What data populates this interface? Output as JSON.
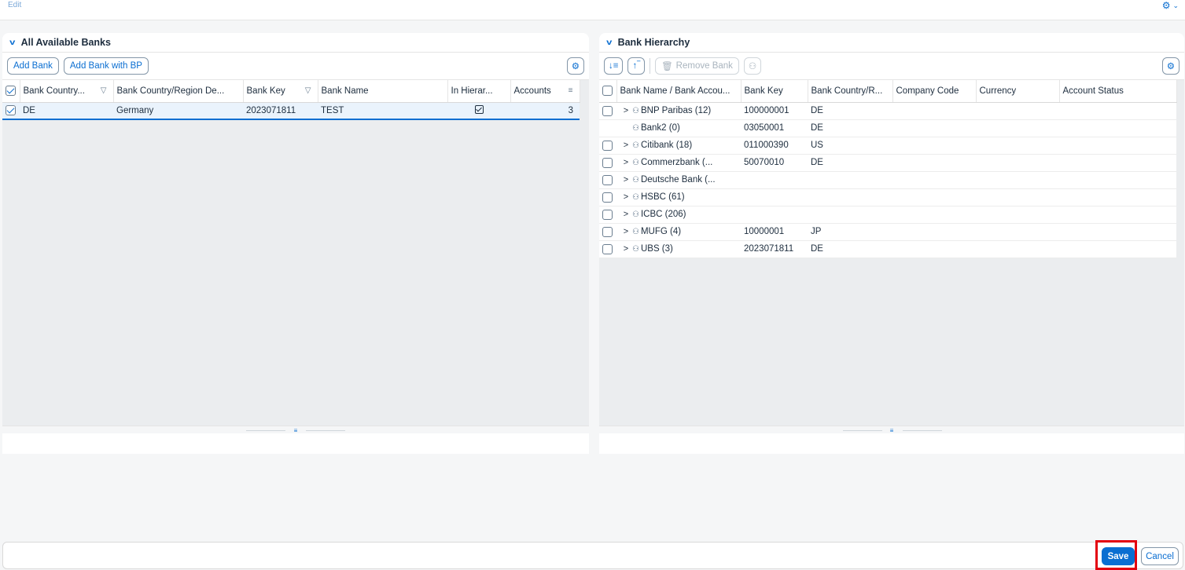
{
  "header": {
    "edit_label": "Edit"
  },
  "left_panel": {
    "title": "All Available Banks",
    "toolbar": {
      "add_bank": "Add Bank",
      "add_bank_bp": "Add Bank with BP"
    },
    "columns": [
      "Bank Country...",
      "Bank Country/Region De...",
      "Bank Key",
      "Bank Name",
      "In Hierar...",
      "Accounts"
    ],
    "rows": [
      {
        "country": "DE",
        "country_desc": "Germany",
        "bank_key": "2023071811",
        "bank_name": "TEST",
        "in_hierarchy": true,
        "accounts": "3",
        "selected": true
      }
    ]
  },
  "right_panel": {
    "title": "Bank Hierarchy",
    "toolbar": {
      "remove_bank": "Remove Bank"
    },
    "columns": [
      "Bank Name / Bank Accou...",
      "Bank Key",
      "Bank Country/R...",
      "Company Code",
      "Currency",
      "Account Status"
    ],
    "rows": [
      {
        "name": "BNP Paribas (12)",
        "bank_key": "100000001",
        "country": "DE",
        "expandable": true,
        "checkbox": true
      },
      {
        "name": "Bank2 (0)",
        "bank_key": "03050001",
        "country": "DE",
        "expandable": false,
        "checkbox": false
      },
      {
        "name": "Citibank (18)",
        "bank_key": "011000390",
        "country": "US",
        "expandable": true,
        "checkbox": true
      },
      {
        "name": "Commerzbank (...",
        "bank_key": "50070010",
        "country": "DE",
        "expandable": true,
        "checkbox": true
      },
      {
        "name": "Deutsche Bank (...",
        "bank_key": "",
        "country": "",
        "expandable": true,
        "checkbox": true
      },
      {
        "name": "HSBC (61)",
        "bank_key": "",
        "country": "",
        "expandable": true,
        "checkbox": true
      },
      {
        "name": "ICBC (206)",
        "bank_key": "",
        "country": "",
        "expandable": true,
        "checkbox": true
      },
      {
        "name": "MUFG (4)",
        "bank_key": "10000001",
        "country": "JP",
        "expandable": true,
        "checkbox": true
      },
      {
        "name": "UBS (3)",
        "bank_key": "2023071811",
        "country": "DE",
        "expandable": true,
        "checkbox": true
      }
    ]
  },
  "footer": {
    "save": "Save",
    "cancel": "Cancel"
  },
  "colors": {
    "accent": "#0a6ed1",
    "highlight": "#e3000f"
  }
}
